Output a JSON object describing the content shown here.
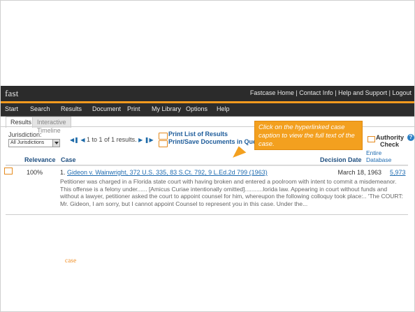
{
  "header": {
    "logo_fast": "fast",
    "logo_case": "case",
    "links": "Fastcase Home | Contact Info | Help and Support | Logout"
  },
  "nav": [
    "Start",
    "Search",
    "Results",
    "Document",
    "Print",
    "My Library",
    "Options",
    "Help"
  ],
  "subtabs": [
    "Results",
    "Interactive Timeline"
  ],
  "jurisdiction": {
    "label": "Jurisdiction:",
    "selected": "All Jurisdictions"
  },
  "pager": {
    "text": "1 to 1 of 1 results."
  },
  "print": {
    "list": "Print List of Results",
    "docs": "Print/Save Documents in Queue"
  },
  "callout": {
    "text": "Click on the hyperlinked case caption to view the full text of the case."
  },
  "authority": {
    "title_line1": "Authority",
    "title_line2": "Check",
    "entire": "Entire",
    "database": "Database"
  },
  "columns": {
    "relevance": "Relevance",
    "case": "Case",
    "date": "Decision Date"
  },
  "result": {
    "relevance": "100%",
    "number": "1.",
    "caption": "Gideon v. Wainwright, 372 U.S. 335, 83 S.Ct. 792, 9 L.Ed.2d 799 (1963)",
    "date": "March 18, 1963",
    "cites": "5,973",
    "snippet": "Petitioner was charged in a Florida state court with having broken and entered a poolroom with intent to commit a misdemeanor. This offense is a felony under...... [Amicus Curiae intentionally omitted]...........lorida law. Appearing in court without funds and without a lawyer, petitioner asked the court to appoint counsel for him, whereupon the following colloquy took place:.. 'The COURT: Mr. Gideon, I am sorry, but I cannot appoint Counsel to represent you in this case. Under the..."
  },
  "colors": {
    "orange": "#f39a1e",
    "dark": "#2b2b2b",
    "link": "#1e6bb0"
  }
}
